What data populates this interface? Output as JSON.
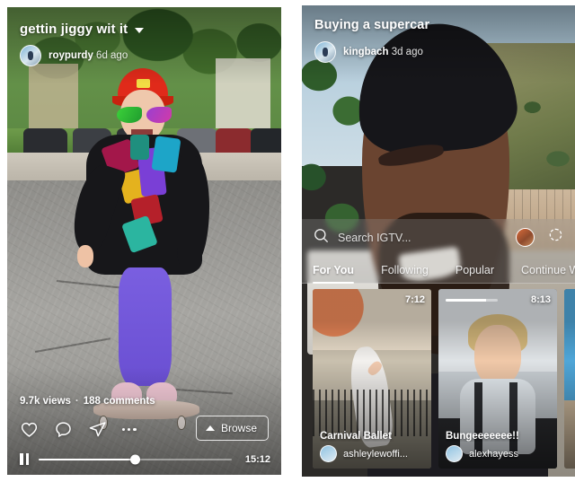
{
  "left_phone": {
    "video": {
      "title": "gettin jiggy wit it",
      "author": "roypurdy",
      "time_ago": "6d ago",
      "views": "9.7k views",
      "separator": "·",
      "comments": "188 comments",
      "duration": "15:12"
    },
    "actions": {
      "like": "heart-icon",
      "comment": "comment-icon",
      "share": "share-icon",
      "more": "more-icon",
      "browse_label": "Browse"
    },
    "player": {
      "pause": "pause-icon",
      "progress_percent": 50
    }
  },
  "right_phone": {
    "video": {
      "title": "Buying a supercar",
      "author": "kingbach",
      "time_ago": "3d ago"
    },
    "browse_sheet": {
      "search_placeholder": "Search IGTV...",
      "tabs": [
        {
          "label": "For You",
          "active": true
        },
        {
          "label": "Following",
          "active": false
        },
        {
          "label": "Popular",
          "active": false
        },
        {
          "label": "Continue W",
          "active": false
        }
      ],
      "cards": [
        {
          "title": "Carnival Ballet",
          "username": "ashleylewoffi...",
          "duration": "7:12",
          "progress_percent": 0
        },
        {
          "title": "Bungeeeeeee!!",
          "username": "alexhayess",
          "duration": "8:13",
          "progress_percent": 78
        },
        {
          "title": "",
          "username": "",
          "duration": "",
          "progress_percent": 0
        }
      ]
    }
  },
  "colors": {
    "accent_white": "#ffffff",
    "overlay_dark": "#000000",
    "sheet_tint": "#969696"
  }
}
